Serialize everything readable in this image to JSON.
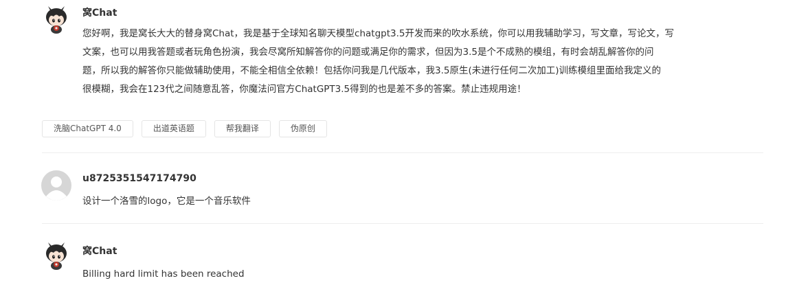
{
  "messages": [
    {
      "sender": "窝Chat",
      "lines": [
        "您好啊，我是窝长大大的替身窝Chat，我是基于全球知名聊天模型chatgpt3.5开发而来的吹水系统，你可以用我辅助学习，写文章，写论文，写",
        "文案，也可以用我答题或者玩角色扮演，我会尽窝所知解答你的问题或满足你的需求，但因为3.5是个不成熟的模组，有时会胡乱解答你的问",
        "题，所以我的解答你只能做辅助使用，不能全相信全依赖！包括你问我是几代版本，我3.5原生(未进行任何二次加工)训练模组里面给我定义的",
        "很模糊，我会在123代之间随意乱答，你魔法问官方ChatGPT3.5得到的也是差不多的答案。禁止违规用途！"
      ],
      "avatar_icon": "chibi-girl-avatar-icon"
    },
    {
      "sender": "u8725351547174790",
      "text": "设计一个洛雪的logo，它是一个音乐软件",
      "avatar_icon": "default-user-avatar-icon"
    },
    {
      "sender": "窝Chat",
      "text": "Billing hard limit has been reached",
      "avatar_icon": "chibi-girl-avatar-icon"
    }
  ],
  "suggestions": [
    "洗脑ChatGPT 4.0",
    "出道英语题",
    "帮我翻译",
    "伪原创"
  ]
}
